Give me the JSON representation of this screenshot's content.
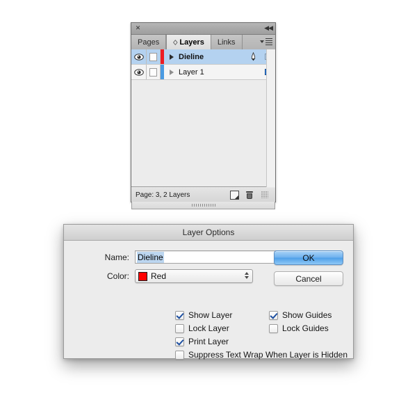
{
  "panel": {
    "close_icon": "close-icon",
    "collapse_icon": "collapse-icon",
    "tabs": [
      {
        "label": "Pages",
        "active": false
      },
      {
        "label": "Layers",
        "active": true
      },
      {
        "label": "Links",
        "active": false
      }
    ],
    "menu_icon": "panel-menu-icon",
    "layers": [
      {
        "name": "Dieline",
        "color": "#ed1c24",
        "visible": true,
        "locked": false,
        "selected": true,
        "has_target_pen": true,
        "selection_square": "empty"
      },
      {
        "name": "Layer 1",
        "color": "#4a9ae1",
        "visible": true,
        "locked": false,
        "selected": false,
        "has_target_pen": false,
        "selection_square": "filled"
      }
    ],
    "footer": {
      "status": "Page: 3, 2 Layers",
      "new_layer_icon": "new-layer-icon",
      "delete_layer_icon": "trash-icon",
      "resize_grip_icon": "resize-grip-icon"
    }
  },
  "dialog": {
    "title": "Layer Options",
    "name_label": "Name:",
    "name_value": "Dieline",
    "color_label": "Color:",
    "color_value": "Red",
    "color_hex": "#ff0000",
    "buttons": {
      "ok": "OK",
      "cancel": "Cancel"
    },
    "checkboxes": [
      {
        "label": "Show Layer",
        "checked": true
      },
      {
        "label": "Show Guides",
        "checked": true
      },
      {
        "label": "Lock Layer",
        "checked": false
      },
      {
        "label": "Lock Guides",
        "checked": false
      },
      {
        "label": "Print Layer",
        "checked": true
      },
      {
        "label": "",
        "checked": false
      },
      {
        "label": "Suppress Text Wrap When Layer is Hidden",
        "checked": false
      }
    ]
  }
}
